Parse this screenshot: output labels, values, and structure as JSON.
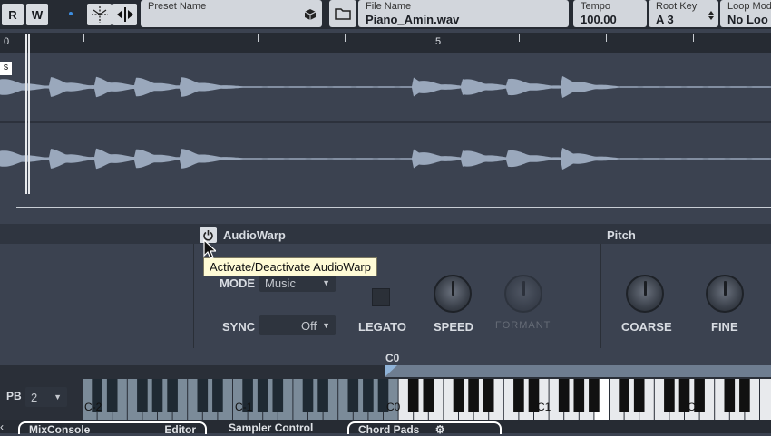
{
  "toolbar": {
    "r_label": "R",
    "w_label": "W",
    "preset": {
      "label": "Preset Name",
      "value": ""
    },
    "file": {
      "label": "File Name",
      "value": "Piano_Amin.wav"
    },
    "tempo": {
      "label": "Tempo",
      "value": "100.00"
    },
    "root_key": {
      "label": "Root Key",
      "value": "A 3"
    },
    "loop_mode": {
      "label": "Loop Mod",
      "value": "No Loo"
    }
  },
  "ruler": {
    "marks": [
      "0",
      "5"
    ]
  },
  "marker_s": "s",
  "audiowarp": {
    "title": "AudioWarp",
    "tooltip": "Activate/Deactivate AudioWarp",
    "mode_label": "MODE",
    "mode_value": "Music",
    "sync_label": "SYNC",
    "sync_value": "Off",
    "legato_label": "LEGATO",
    "speed_label": "SPEED",
    "formant_label": "FORMANT"
  },
  "pitch": {
    "title": "Pitch",
    "coarse_label": "COARSE",
    "fine_label": "FINE"
  },
  "keyboard": {
    "pb_label": "PB",
    "pb_value": "2",
    "range_label": "C0",
    "octaves": [
      "C-2",
      "C-1",
      "C0",
      "C1",
      "C2"
    ]
  },
  "tabs": [
    "MixConsole",
    "Editor",
    "Sampler Control",
    "Chord Pads"
  ],
  "colors": {
    "waveform": "#9aa8bc",
    "background": "#3b4250",
    "accent": "#8fb3d8"
  }
}
